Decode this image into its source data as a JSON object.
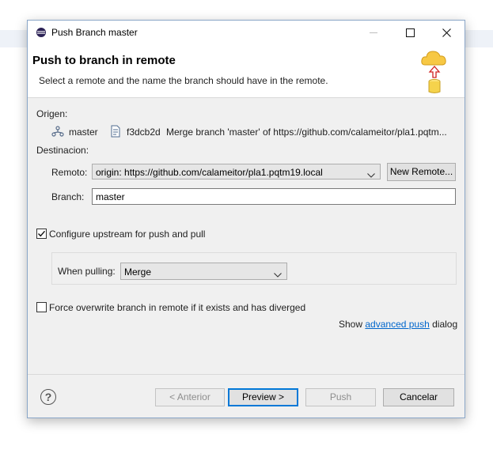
{
  "window": {
    "title": "Push Branch master"
  },
  "header": {
    "title": "Push to branch in remote",
    "description": "Select a remote and the name the branch should have in the remote."
  },
  "source": {
    "label": "Origen:",
    "branch": "master",
    "commit_id": "f3dcb2d",
    "commit_message": "Merge branch 'master' of https://github.com/calameitor/pla1.pqtm..."
  },
  "destination": {
    "label": "Destinacion:",
    "remote_label": "Remoto:",
    "remote_value": "origin: https://github.com/calameitor/pla1.pqtm19.local",
    "new_remote_label": "New Remote...",
    "branch_label": "Branch:",
    "branch_value": "master"
  },
  "upstream": {
    "checkbox_label": "Configure upstream for push and pull",
    "checked": true,
    "when_pulling_label": "When pulling:",
    "when_pulling_value": "Merge"
  },
  "force": {
    "checkbox_label": "Force overwrite branch in remote if it exists and has diverged",
    "checked": false
  },
  "advanced": {
    "prefix": "Show",
    "link": "advanced push",
    "suffix": "dialog"
  },
  "footer": {
    "back_label": "< Anterior",
    "next_label": "Preview >",
    "push_label": "Push",
    "cancel_label": "Cancelar"
  },
  "icons": {
    "app": "eclipse-icon",
    "branch": "branch-icon",
    "commit": "commit-icon",
    "wizard": "cloud-push-icon",
    "help": "help-icon"
  }
}
